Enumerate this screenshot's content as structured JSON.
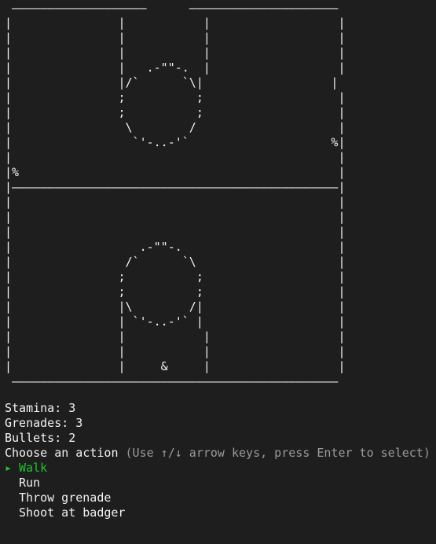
{
  "map": {
    "rows": [
      " ———————————————————      —————————————————————",
      "|               |           |                  |",
      "|               |           |                  |",
      "|               |           |                  |",
      "|               |   .-\"\"-.  |                  |",
      "|               |/`      `\\|                  |",
      "|               ;          ;                   |",
      "|               ;          ;                   |",
      "|                \\        /                    |",
      "|                 `'-..-'`                    %|",
      "|                                              |",
      "|%                                             |",
      "|——————————————————————————————————————————————|",
      "|                                              |",
      "|                                              |",
      "|                                              |",
      "|                  .-\"\"-.                      |",
      "|                /`      `\\                    |",
      "|               ;          ;                   |",
      "|               ;          ;                   |",
      "|               |\\        /|                   |",
      "|               | `'-..-'` |                   |",
      "|               |           |                  |",
      "|               |           |                  |",
      "|               |     &     |                  |",
      " ——————————————————————————————————————————————"
    ]
  },
  "stats": {
    "stamina": "Stamina: 3",
    "grenades": "Grenades: 3",
    "bullets": "Bullets: 2"
  },
  "prompt": {
    "text": "Choose an action",
    "hint": "(Use ↑/↓ arrow keys, press Enter to select)"
  },
  "menu": {
    "pointer": "▸",
    "items": [
      "Walk",
      "Run",
      "Throw grenade",
      "Shoot at badger"
    ],
    "selected_index": 0
  },
  "colors": {
    "background": "#1e1e1e",
    "text": "#f2f2f2",
    "hint": "#9a9a9a",
    "selected": "#21c42a"
  }
}
